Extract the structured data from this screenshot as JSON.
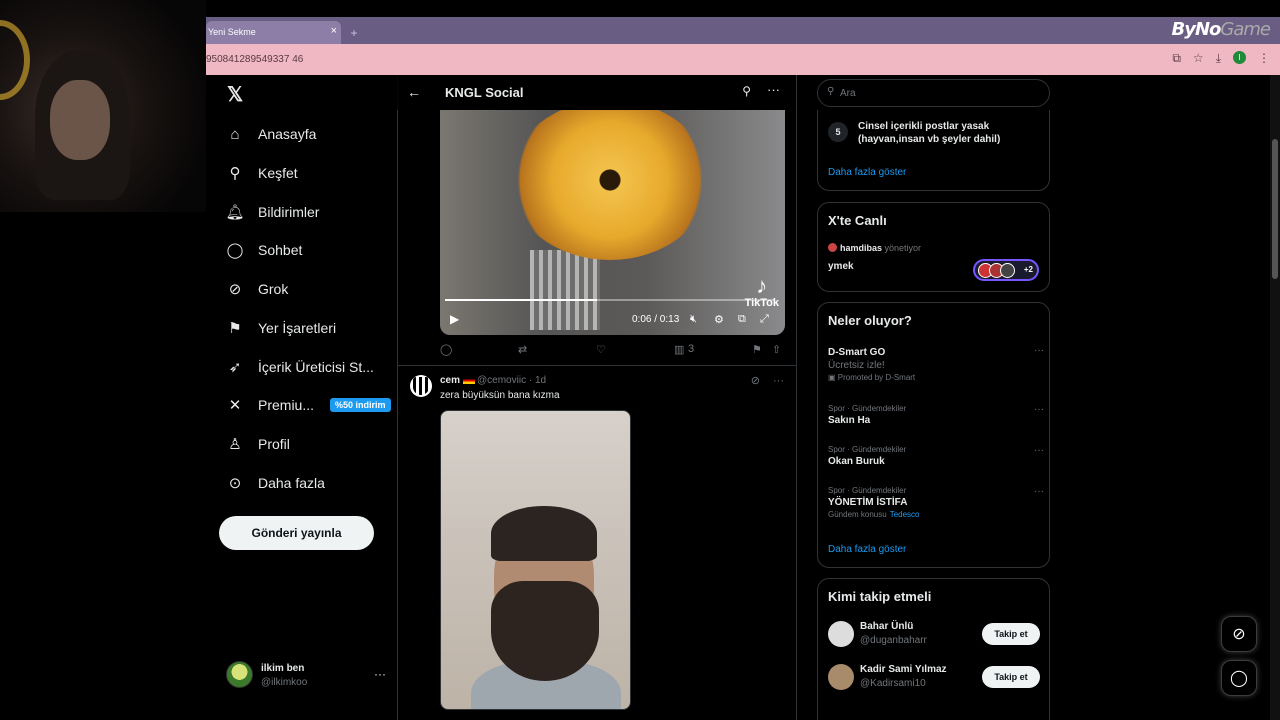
{
  "browser": {
    "tab_label": "Yeni Sekme",
    "tab_close": "×",
    "new_tab": "+",
    "address": "950841289549337 46",
    "brand_logo_main": "ByNo",
    "brand_logo_dim": "Game"
  },
  "sidebar": {
    "items": [
      {
        "label": "Anasayfa",
        "icon": "home-icon",
        "glyph": "⌂"
      },
      {
        "label": "Keşfet",
        "icon": "search-icon",
        "glyph": "⚲"
      },
      {
        "label": "Bildirimler",
        "icon": "bell-icon",
        "glyph": "🔔︎"
      },
      {
        "label": "Sohbet",
        "icon": "chat-icon",
        "glyph": "◯"
      },
      {
        "label": "Grok",
        "icon": "grok-icon",
        "glyph": "⊘"
      },
      {
        "label": "Yer İşaretleri",
        "icon": "bookmark-icon",
        "glyph": "⚑"
      },
      {
        "label": "İçerik Üreticisi St...",
        "icon": "rocket-icon",
        "glyph": "➶"
      },
      {
        "label": "Premiu...",
        "icon": "x-icon",
        "glyph": "✕"
      },
      {
        "label": "Profil",
        "icon": "profile-icon",
        "glyph": "♙"
      },
      {
        "label": "Daha fazla",
        "icon": "more-circle-icon",
        "glyph": "⊙"
      }
    ],
    "premium_badge": "%50 indirim",
    "post_button": "Gönderi yayınla",
    "user": {
      "name": "ilkim ben",
      "handle": "@ilkimkoo",
      "more": "···"
    }
  },
  "main": {
    "back": "←",
    "title": "KNGL Social",
    "search": "⚲",
    "more": "···",
    "video1": {
      "time": "0:06 / 0:13",
      "progress": 0.46,
      "watermark": "TikTok"
    },
    "actions": {
      "reply": "◯",
      "repost": "⇄",
      "like": "♡",
      "views_icon": "▥",
      "views": "3",
      "bookmark": "⚑",
      "share": "⇧"
    },
    "tweet2": {
      "name": "cem",
      "handle": "@cemoviic · 1d",
      "text": "zera büyüksün bana kızma",
      "grok": "⊘",
      "more": "···"
    }
  },
  "right": {
    "search_placeholder": "Ara",
    "rules": {
      "num": "5",
      "text": "Cinsel içerikli postlar yasak (hayvan,insan vb şeyler dahil)",
      "show_more": "Daha fazla göster"
    },
    "live": {
      "title": "X'te Canlı",
      "host": "hamdibas",
      "host_role": "yönetiyor",
      "space_title": "ymek",
      "extra": "+2"
    },
    "trends": {
      "title": "Neler oluyor?",
      "items": [
        {
          "meta": "",
          "topic": "D-Smart GO",
          "sub": "Ücretsiz izle!",
          "promo": "Promoted by D-Smart"
        },
        {
          "meta": "Spor · Gündemdekiler",
          "topic": "Sakın Ha",
          "sub": ""
        },
        {
          "meta": "Spor · Gündemdekiler",
          "topic": "Okan Buruk",
          "sub": ""
        },
        {
          "meta": "Spor · Gündemdekiler",
          "topic": "YÖNETİM İSTİFA",
          "sub": "Gündem konusu",
          "sub_link": "Tedesco"
        }
      ],
      "show_more": "Daha fazla göster"
    },
    "who_to_follow": {
      "title": "Kimi takip etmeli",
      "items": [
        {
          "name": "Bahar Ünlü",
          "handle": "@duganbaharr",
          "button": "Takip et"
        },
        {
          "name": "Kadir Sami Yılmaz",
          "handle": "@Kadirsami10",
          "button": "Takip et"
        }
      ]
    }
  },
  "colors": {
    "accent": "#1d9bf0",
    "tabbar": "#6a5d84",
    "addrbar": "#f0b8c3",
    "border": "#2f3336"
  }
}
